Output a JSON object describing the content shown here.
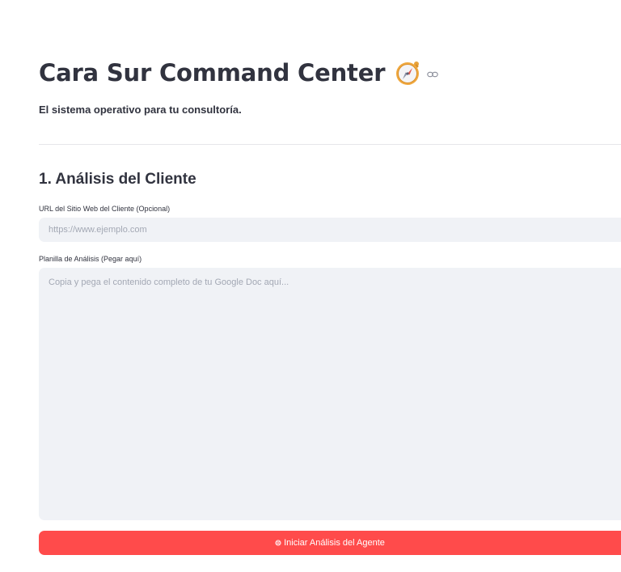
{
  "header": {
    "title": "Cara Sur Command Center",
    "title_icon": "compass-icon",
    "anchor_icon": "link-icon",
    "subtitle": "El sistema operativo para tu consultoría."
  },
  "section": {
    "title": "1. Análisis del Cliente"
  },
  "url_field": {
    "label": "URL del Sitio Web del Cliente (Opcional)",
    "value": "",
    "placeholder": "https://www.ejemplo.com"
  },
  "analysis_field": {
    "label": "Planilla de Análisis (Pegar aquí)",
    "value": "",
    "placeholder": "Copia y pega el contenido completo de tu Google Doc aquí..."
  },
  "action_button": {
    "icon": "brain-icon",
    "label": "Iniciar Análisis del Agente"
  },
  "colors": {
    "primary": "#ff4b4b",
    "text": "#31333f",
    "input_background": "#f0f2f6",
    "placeholder": "#a3a8b4"
  }
}
